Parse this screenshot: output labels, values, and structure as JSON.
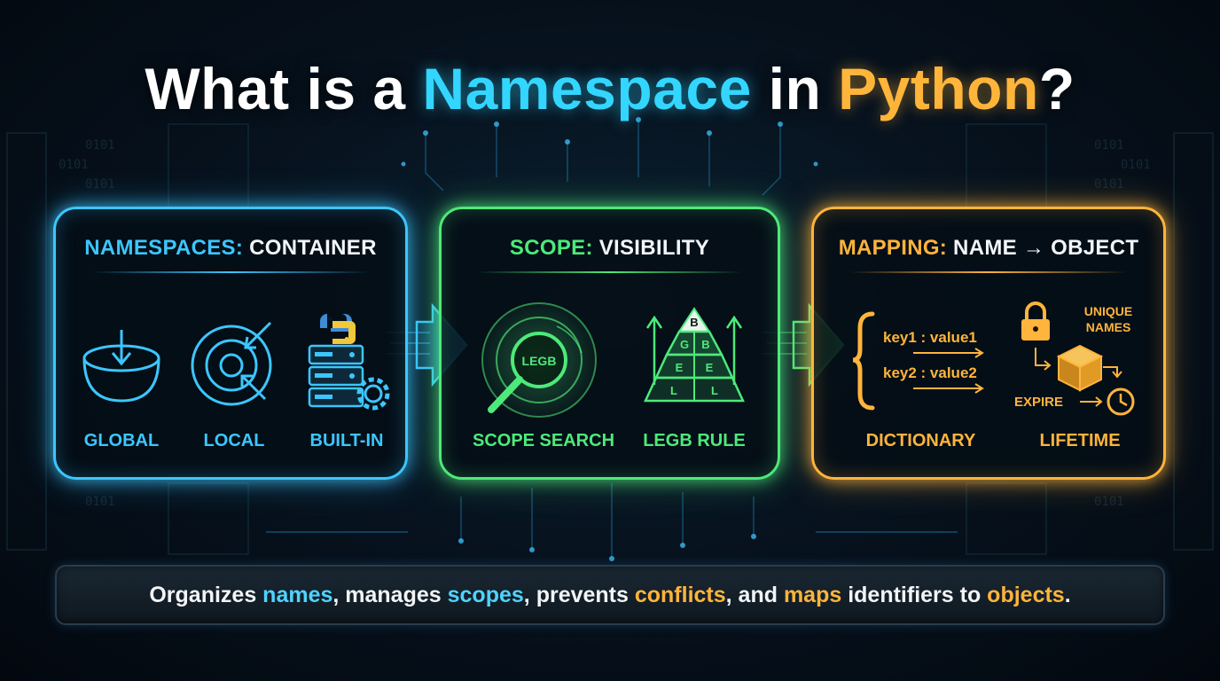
{
  "title": {
    "part1": "What is a ",
    "part2": "Namespace",
    "part3": " in ",
    "part4": "Python",
    "part5": "?"
  },
  "panels": [
    {
      "heading_key": "NAMESPACES:",
      "heading_rest": " CONTAINER",
      "color": "#3cc6ff",
      "items": [
        {
          "label": "GLOBAL",
          "icon": "bowl-arrow-icon"
        },
        {
          "label": "LOCAL",
          "icon": "target-arrows-icon"
        },
        {
          "label": "BUILT-IN",
          "icon": "python-server-gear-icon"
        }
      ]
    },
    {
      "heading_key": "SCOPE:",
      "heading_rest": " VISIBILITY",
      "color": "#4dea7a",
      "items": [
        {
          "label": "SCOPE SEARCH",
          "icon": "magnifier-radar-icon",
          "icon_text": "LEGB"
        },
        {
          "label": "LEGB RULE",
          "icon": "pyramid-icon",
          "pyramid_letters": [
            "B",
            "G",
            "B",
            "E",
            "E",
            "L",
            "L"
          ]
        }
      ]
    },
    {
      "heading_key": "MAPPING:",
      "heading_rest": " NAME → OBJECT",
      "color": "#ffb43b",
      "items": [
        {
          "label": "DICTIONARY",
          "icon": "curly-brace-icon",
          "entries": [
            "key1 : value1",
            "key2 : value2"
          ]
        },
        {
          "label": "LIFETIME",
          "icon": "lock-cube-clock-icon",
          "unique_line1": "UNIQUE",
          "unique_line2": "NAMES",
          "expire": "EXPIRE"
        }
      ]
    }
  ],
  "footer": {
    "t1": "Organizes ",
    "t2": "names",
    "t3": ", manages ",
    "t4": "scopes",
    "t5": ", prevents ",
    "t6": "conflicts",
    "t7": ", and ",
    "t8": "maps",
    "t9": " identifiers to ",
    "t10": "objects",
    "t11": "."
  },
  "background": {
    "binary": "0101"
  }
}
